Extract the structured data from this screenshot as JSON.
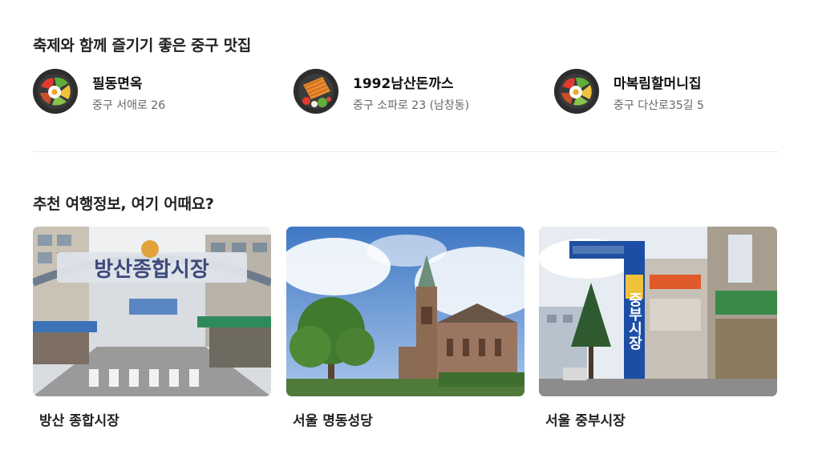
{
  "sections": {
    "restaurants_title": "축제와 함께 즐기기 좋은 중구 맛집",
    "recommend_title": "추천 여행정보, 여기 어때요?"
  },
  "restaurants": [
    {
      "name": "필동면옥",
      "address": "중구 서애로 26",
      "icon": "bibimbap-icon"
    },
    {
      "name": "1992남산돈까스",
      "address": "중구 소파로 23 (남창동)",
      "icon": "pork-cutlet-icon"
    },
    {
      "name": "마복림할머니집",
      "address": "중구 다산로35길 5",
      "icon": "bibimbap-icon"
    }
  ],
  "places": [
    {
      "caption": "방산 종합시장",
      "sign": "방산종합시장"
    },
    {
      "caption": "서울 명동성당"
    },
    {
      "caption": "서울 중부시장",
      "sign": "중부시장"
    }
  ]
}
